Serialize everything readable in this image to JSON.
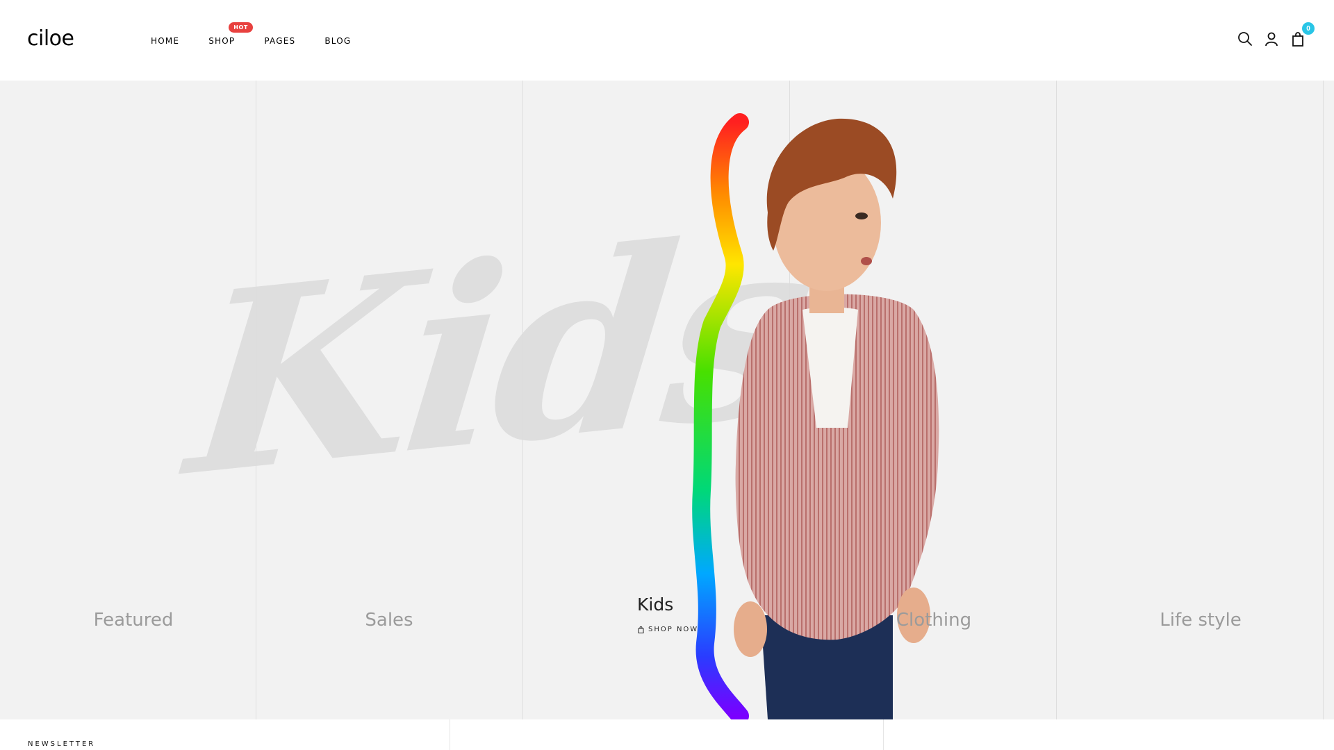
{
  "header": {
    "logo": "ciloe",
    "nav": [
      {
        "label": "HOME"
      },
      {
        "label": "SHOP",
        "badge": "HOT"
      },
      {
        "label": "PAGES"
      },
      {
        "label": "BLOG"
      }
    ],
    "icons": [
      "search-icon",
      "user-icon",
      "shopping-bag-icon"
    ],
    "cart_count": "0",
    "badge_color": "#e8413f",
    "cart_badge_color": "#29c5e6"
  },
  "hero": {
    "background_script": "Kids",
    "columns": [
      {
        "title": "Featured"
      },
      {
        "title": "Sales"
      },
      {
        "title": "Kids"
      },
      {
        "title": "Clothing"
      },
      {
        "title": "Life style"
      }
    ],
    "active_title": "Kids",
    "cta_label": "SHOP NOW"
  },
  "footer": {
    "newsletter_label": "NEWSLETTER"
  }
}
